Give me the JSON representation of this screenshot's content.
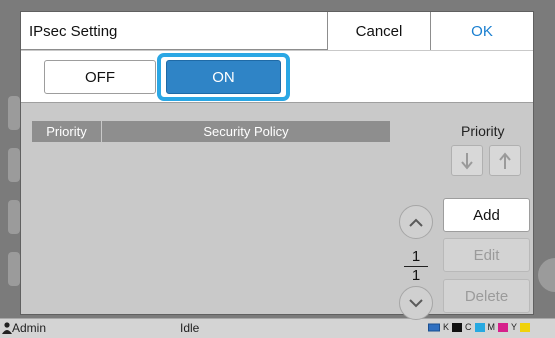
{
  "dialog": {
    "title": "IPsec Setting",
    "cancel_label": "Cancel",
    "ok_label": "OK"
  },
  "toggle": {
    "off_label": "OFF",
    "on_label": "ON",
    "selected": "ON"
  },
  "table": {
    "columns": [
      "Priority",
      "Security Policy"
    ],
    "rows": []
  },
  "priority": {
    "label": "Priority",
    "down_icon": "arrow-down-icon",
    "up_icon": "arrow-up-icon"
  },
  "paging": {
    "current": "1",
    "total": "1"
  },
  "actions": {
    "add_label": "Add",
    "edit_label": "Edit",
    "delete_label": "Delete"
  },
  "status_bar": {
    "user": "Admin",
    "state": "Idle",
    "ink": [
      "K",
      "C",
      "M",
      "Y"
    ]
  },
  "colors": {
    "accent": "#2f84c6",
    "highlight": "#2ba7e4",
    "ok_text": "#1a7fd0"
  }
}
